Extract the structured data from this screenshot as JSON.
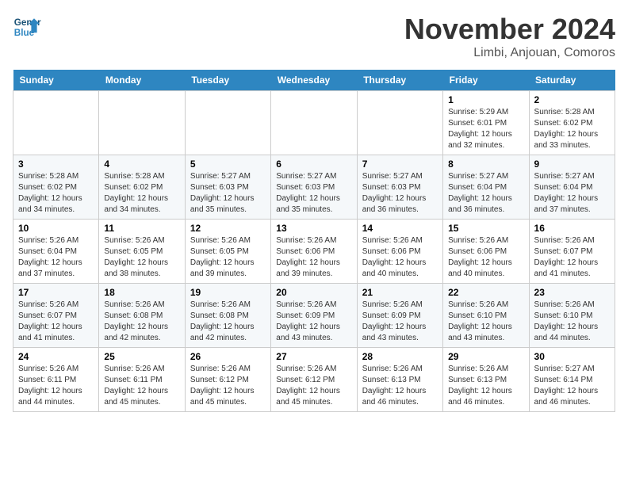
{
  "header": {
    "logo_line1": "General",
    "logo_line2": "Blue",
    "month": "November 2024",
    "location": "Limbi, Anjouan, Comoros"
  },
  "weekdays": [
    "Sunday",
    "Monday",
    "Tuesday",
    "Wednesday",
    "Thursday",
    "Friday",
    "Saturday"
  ],
  "weeks": [
    [
      {
        "day": "",
        "info": ""
      },
      {
        "day": "",
        "info": ""
      },
      {
        "day": "",
        "info": ""
      },
      {
        "day": "",
        "info": ""
      },
      {
        "day": "",
        "info": ""
      },
      {
        "day": "1",
        "info": "Sunrise: 5:29 AM\nSunset: 6:01 PM\nDaylight: 12 hours and 32 minutes."
      },
      {
        "day": "2",
        "info": "Sunrise: 5:28 AM\nSunset: 6:02 PM\nDaylight: 12 hours and 33 minutes."
      }
    ],
    [
      {
        "day": "3",
        "info": "Sunrise: 5:28 AM\nSunset: 6:02 PM\nDaylight: 12 hours and 34 minutes."
      },
      {
        "day": "4",
        "info": "Sunrise: 5:28 AM\nSunset: 6:02 PM\nDaylight: 12 hours and 34 minutes."
      },
      {
        "day": "5",
        "info": "Sunrise: 5:27 AM\nSunset: 6:03 PM\nDaylight: 12 hours and 35 minutes."
      },
      {
        "day": "6",
        "info": "Sunrise: 5:27 AM\nSunset: 6:03 PM\nDaylight: 12 hours and 35 minutes."
      },
      {
        "day": "7",
        "info": "Sunrise: 5:27 AM\nSunset: 6:03 PM\nDaylight: 12 hours and 36 minutes."
      },
      {
        "day": "8",
        "info": "Sunrise: 5:27 AM\nSunset: 6:04 PM\nDaylight: 12 hours and 36 minutes."
      },
      {
        "day": "9",
        "info": "Sunrise: 5:27 AM\nSunset: 6:04 PM\nDaylight: 12 hours and 37 minutes."
      }
    ],
    [
      {
        "day": "10",
        "info": "Sunrise: 5:26 AM\nSunset: 6:04 PM\nDaylight: 12 hours and 37 minutes."
      },
      {
        "day": "11",
        "info": "Sunrise: 5:26 AM\nSunset: 6:05 PM\nDaylight: 12 hours and 38 minutes."
      },
      {
        "day": "12",
        "info": "Sunrise: 5:26 AM\nSunset: 6:05 PM\nDaylight: 12 hours and 39 minutes."
      },
      {
        "day": "13",
        "info": "Sunrise: 5:26 AM\nSunset: 6:06 PM\nDaylight: 12 hours and 39 minutes."
      },
      {
        "day": "14",
        "info": "Sunrise: 5:26 AM\nSunset: 6:06 PM\nDaylight: 12 hours and 40 minutes."
      },
      {
        "day": "15",
        "info": "Sunrise: 5:26 AM\nSunset: 6:06 PM\nDaylight: 12 hours and 40 minutes."
      },
      {
        "day": "16",
        "info": "Sunrise: 5:26 AM\nSunset: 6:07 PM\nDaylight: 12 hours and 41 minutes."
      }
    ],
    [
      {
        "day": "17",
        "info": "Sunrise: 5:26 AM\nSunset: 6:07 PM\nDaylight: 12 hours and 41 minutes."
      },
      {
        "day": "18",
        "info": "Sunrise: 5:26 AM\nSunset: 6:08 PM\nDaylight: 12 hours and 42 minutes."
      },
      {
        "day": "19",
        "info": "Sunrise: 5:26 AM\nSunset: 6:08 PM\nDaylight: 12 hours and 42 minutes."
      },
      {
        "day": "20",
        "info": "Sunrise: 5:26 AM\nSunset: 6:09 PM\nDaylight: 12 hours and 43 minutes."
      },
      {
        "day": "21",
        "info": "Sunrise: 5:26 AM\nSunset: 6:09 PM\nDaylight: 12 hours and 43 minutes."
      },
      {
        "day": "22",
        "info": "Sunrise: 5:26 AM\nSunset: 6:10 PM\nDaylight: 12 hours and 43 minutes."
      },
      {
        "day": "23",
        "info": "Sunrise: 5:26 AM\nSunset: 6:10 PM\nDaylight: 12 hours and 44 minutes."
      }
    ],
    [
      {
        "day": "24",
        "info": "Sunrise: 5:26 AM\nSunset: 6:11 PM\nDaylight: 12 hours and 44 minutes."
      },
      {
        "day": "25",
        "info": "Sunrise: 5:26 AM\nSunset: 6:11 PM\nDaylight: 12 hours and 45 minutes."
      },
      {
        "day": "26",
        "info": "Sunrise: 5:26 AM\nSunset: 6:12 PM\nDaylight: 12 hours and 45 minutes."
      },
      {
        "day": "27",
        "info": "Sunrise: 5:26 AM\nSunset: 6:12 PM\nDaylight: 12 hours and 45 minutes."
      },
      {
        "day": "28",
        "info": "Sunrise: 5:26 AM\nSunset: 6:13 PM\nDaylight: 12 hours and 46 minutes."
      },
      {
        "day": "29",
        "info": "Sunrise: 5:26 AM\nSunset: 6:13 PM\nDaylight: 12 hours and 46 minutes."
      },
      {
        "day": "30",
        "info": "Sunrise: 5:27 AM\nSunset: 6:14 PM\nDaylight: 12 hours and 46 minutes."
      }
    ]
  ]
}
